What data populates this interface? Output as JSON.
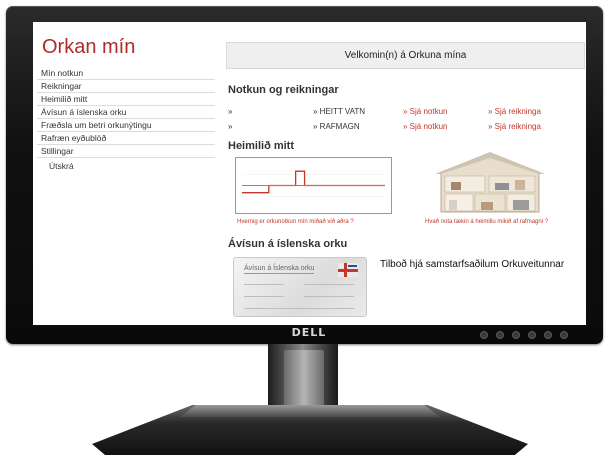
{
  "site": {
    "title": "Orkan mín"
  },
  "monitor": {
    "brand": "DELL"
  },
  "nav": {
    "items": [
      {
        "label": "Mín notkun"
      },
      {
        "label": "Reikningar"
      },
      {
        "label": "Heimilið mitt"
      },
      {
        "label": "Ávísun á íslenska orku"
      },
      {
        "label": "Fræðsla um betri orkunýtingu"
      },
      {
        "label": "Rafræn eyðublöð"
      },
      {
        "label": "Stillingar"
      }
    ],
    "logout": "Útskrá"
  },
  "banner": {
    "text": "Velkomin(n) á Orkuna mína"
  },
  "usage": {
    "heading": "Notkun og reikningar",
    "rows": [
      {
        "arrow": "»",
        "name": "» HEITT VATN",
        "usage_link": "» Sjá notkun",
        "invoice_link": "» Sjá reikninga"
      },
      {
        "arrow": "»",
        "name": "» RAFMAGN",
        "usage_link": "» Sjá notkun",
        "invoice_link": "» Sjá reikninga"
      }
    ]
  },
  "home": {
    "heading": "Heimilið mitt",
    "chart_caption": "Hvernig er orkunotkun mín miðað við aðra ?",
    "house_caption": "Hvað nota tækin á heimiliu mikið af rafmagni ?"
  },
  "voucher": {
    "heading": "Ávísun á íslenska orku",
    "card_title": "Ávísun á Íslenska orku",
    "offer_text": "Tilboð hjá samstarfsaðilum Orkuveitunnar"
  },
  "colors": {
    "brand": "#b02a2a",
    "link": "#c0392b",
    "series_red": "#c0392b",
    "series_teal": "#4aa3a0"
  },
  "chart_data": {
    "type": "line",
    "series": [
      {
        "values": [
          2,
          2,
          2,
          3,
          3,
          3,
          5,
          3,
          3,
          3,
          3,
          3,
          3,
          3,
          3,
          3,
          3
        ]
      },
      {
        "values": [
          3,
          3,
          3,
          3,
          3,
          3,
          3,
          3,
          3,
          3,
          3,
          3,
          3,
          3,
          3,
          3,
          3
        ]
      }
    ],
    "ylim": [
      0,
      6
    ]
  }
}
